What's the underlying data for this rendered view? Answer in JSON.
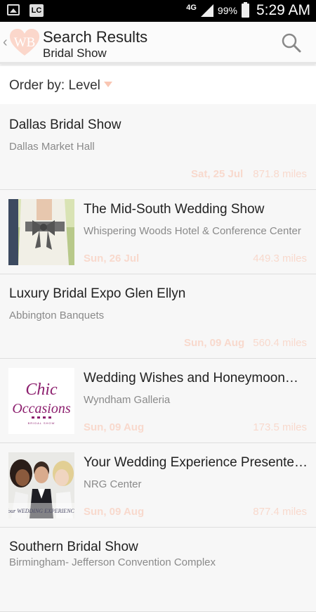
{
  "status_bar": {
    "network": "4G",
    "battery": "99%",
    "time": "5:29 AM"
  },
  "app_bar": {
    "logo_text": "WB",
    "title": "Search Results",
    "subtitle": "Bridal Show"
  },
  "order": {
    "label": "Order by: Level"
  },
  "results": [
    {
      "name": "Dallas Bridal Show",
      "venue": "Dallas Market Hall",
      "date": "Sat, 25 Jul",
      "distance": "871.8 miles",
      "thumb": ""
    },
    {
      "name": "The Mid-South Wedding Show",
      "venue": "Whispering Woods Hotel & Conference Center",
      "date": "Sun, 26 Jul",
      "distance": "449.3 miles",
      "thumb": "dress-photo"
    },
    {
      "name": "Luxury Bridal Expo Glen Ellyn",
      "venue": "Abbington Banquets",
      "date": "Sun, 09 Aug",
      "distance": "560.4 miles",
      "thumb": ""
    },
    {
      "name": "Wedding Wishes and Honeymoon…",
      "venue": "Wyndham Galleria",
      "date": "Sun, 09 Aug",
      "distance": "173.5 miles",
      "thumb": "chic-occasions-logo",
      "thumb_text": "CHIC OCCASIONS",
      "thumb_subtext": "BRIDAL SHOW"
    },
    {
      "name": "Your Wedding Experience Presented…",
      "venue": "NRG Center",
      "date": "Sun, 09 Aug",
      "distance": "877.4 miles",
      "thumb": "couple-photo",
      "thumb_text": "Your WEDDING EXPERIENCE"
    },
    {
      "name": "Southern Bridal Show",
      "venue": "Birmingham- Jefferson Convention Complex",
      "date": "",
      "distance": "",
      "thumb": ""
    }
  ],
  "colors": {
    "accent": "#f9c6b3",
    "date_text": "#f8d9cd",
    "background": "#f7f7f7"
  }
}
